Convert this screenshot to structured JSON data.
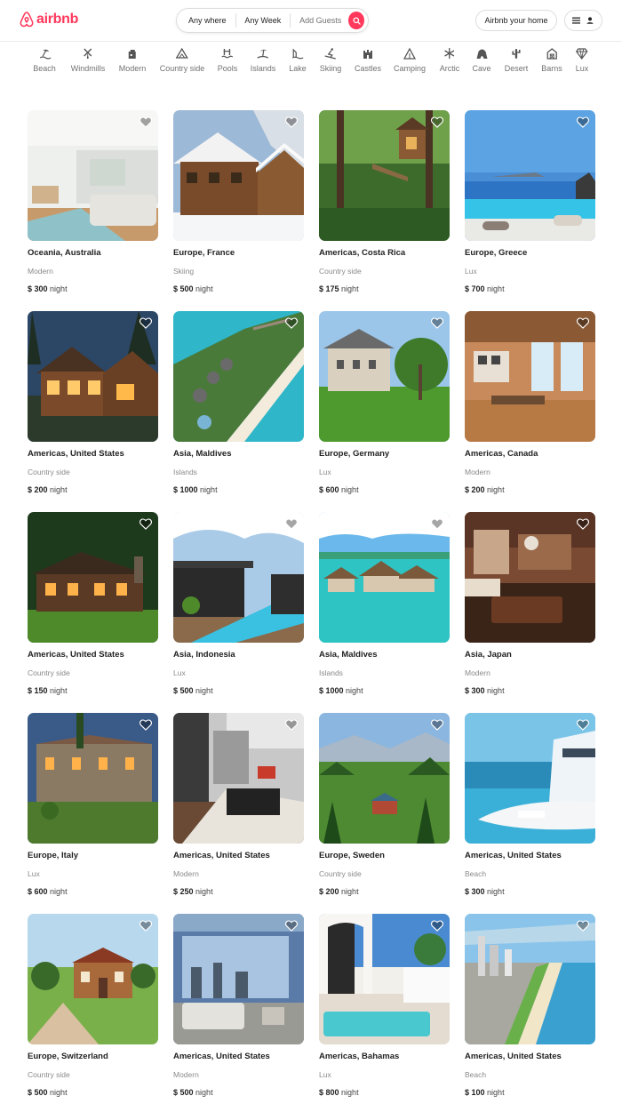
{
  "brand": {
    "name": "airbnb",
    "color": "#ff385c"
  },
  "search": {
    "where": "Any where",
    "week": "Any Week",
    "guests": "Add Guests"
  },
  "header": {
    "host_label": "Airbnb your home"
  },
  "categories": [
    {
      "label": "Beach",
      "icon": "beach-icon"
    },
    {
      "label": "Windmills",
      "icon": "windmill-icon"
    },
    {
      "label": "Modern",
      "icon": "modern-icon"
    },
    {
      "label": "Country side",
      "icon": "countryside-icon"
    },
    {
      "label": "Pools",
      "icon": "pool-icon"
    },
    {
      "label": "Islands",
      "icon": "island-icon"
    },
    {
      "label": "Lake",
      "icon": "lake-icon"
    },
    {
      "label": "Skiing",
      "icon": "skiing-icon"
    },
    {
      "label": "Castles",
      "icon": "castle-icon"
    },
    {
      "label": "Camping",
      "icon": "camping-icon"
    },
    {
      "label": "Arctic",
      "icon": "snowflake-icon"
    },
    {
      "label": "Cave",
      "icon": "cave-icon"
    },
    {
      "label": "Desert",
      "icon": "cactus-icon"
    },
    {
      "label": "Barns",
      "icon": "barn-icon"
    },
    {
      "label": "Lux",
      "icon": "diamond-icon"
    }
  ],
  "listings": [
    {
      "location": "Oceania, Australia",
      "category": "Modern",
      "price": "$ 300",
      "per": "night"
    },
    {
      "location": "Europe, France",
      "category": "Skiing",
      "price": "$ 500",
      "per": "night"
    },
    {
      "location": "Americas, Costa Rica",
      "category": "Country side",
      "price": "$ 175",
      "per": "night"
    },
    {
      "location": "Europe, Greece",
      "category": "Lux",
      "price": "$ 700",
      "per": "night"
    },
    {
      "location": "Americas, United States",
      "category": "Country side",
      "price": "$ 200",
      "per": "night"
    },
    {
      "location": "Asia, Maldives",
      "category": "Islands",
      "price": "$ 1000",
      "per": "night"
    },
    {
      "location": "Europe, Germany",
      "category": "Lux",
      "price": "$ 600",
      "per": "night"
    },
    {
      "location": "Americas, Canada",
      "category": "Modern",
      "price": "$ 200",
      "per": "night"
    },
    {
      "location": "Americas, United States",
      "category": "Country side",
      "price": "$ 150",
      "per": "night"
    },
    {
      "location": "Asia, Indonesia",
      "category": "Lux",
      "price": "$ 500",
      "per": "night"
    },
    {
      "location": "Asia, Maldives",
      "category": "Islands",
      "price": "$ 1000",
      "per": "night"
    },
    {
      "location": "Asia, Japan",
      "category": "Modern",
      "price": "$ 300",
      "per": "night"
    },
    {
      "location": "Europe, Italy",
      "category": "Lux",
      "price": "$ 600",
      "per": "night"
    },
    {
      "location": "Americas, United States",
      "category": "Modern",
      "price": "$ 250",
      "per": "night"
    },
    {
      "location": "Europe, Sweden",
      "category": "Country side",
      "price": "$ 200",
      "per": "night"
    },
    {
      "location": "Americas, United States",
      "category": "Beach",
      "price": "$ 300",
      "per": "night"
    },
    {
      "location": "Europe, Switzerland",
      "category": "Country side",
      "price": "$ 500",
      "per": "night"
    },
    {
      "location": "Americas, United States",
      "category": "Modern",
      "price": "$ 500",
      "per": "night"
    },
    {
      "location": "Americas, Bahamas",
      "category": "Lux",
      "price": "$ 800",
      "per": "night"
    },
    {
      "location": "Americas, United States",
      "category": "Beach",
      "price": "$ 100",
      "per": "night"
    }
  ]
}
